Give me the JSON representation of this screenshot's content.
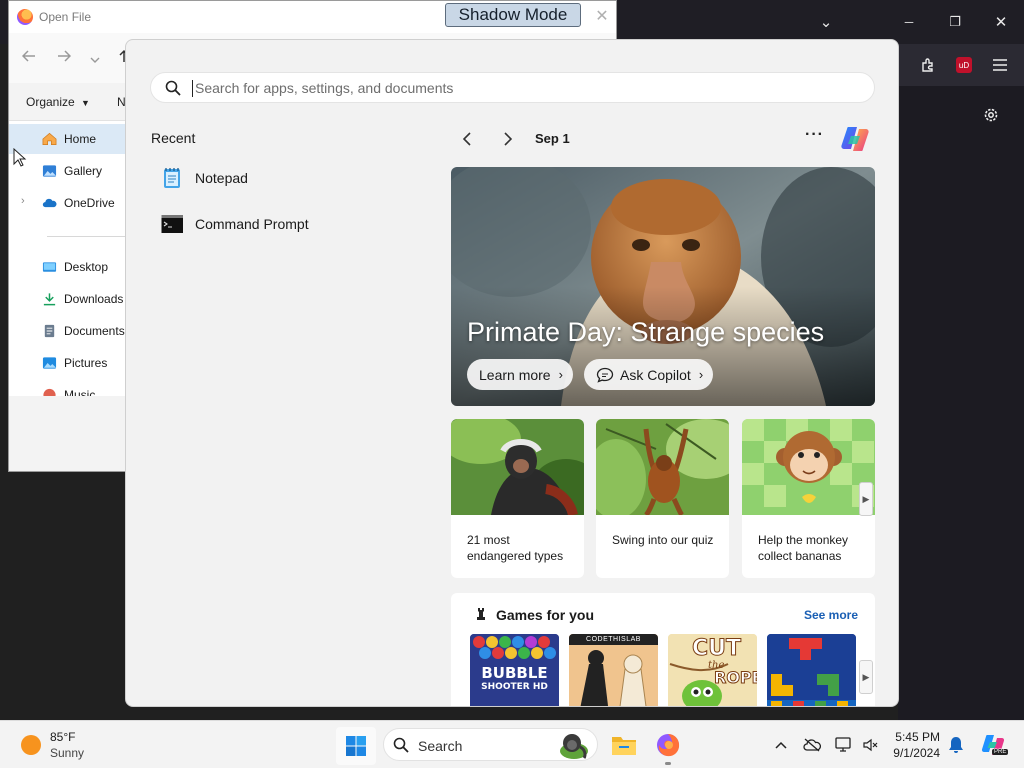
{
  "firefox": {
    "window_controls": {
      "list_all_tabs": "⌄",
      "minimize": "─",
      "maximize": "❐",
      "close": "✕"
    },
    "toolbar_icons": [
      "extensions-icon",
      "ublock-icon",
      "menu-icon"
    ],
    "ublock_badge": "uD"
  },
  "dialog": {
    "title": "Open File",
    "shadow_mode_label": "Shadow Mode",
    "close_glyph": "✕",
    "organize_label": "Organize",
    "new_folder_partial": "N",
    "nav_items": [
      {
        "label": "Home",
        "icon": "home-icon",
        "selected": true
      },
      {
        "label": "Gallery",
        "icon": "gallery-icon"
      },
      {
        "label": "OneDrive",
        "icon": "onedrive-icon",
        "expandable": true
      },
      {
        "label": "Desktop",
        "icon": "desktop-icon"
      },
      {
        "label": "Downloads",
        "icon": "downloads-icon"
      },
      {
        "label": "Documents",
        "icon": "documents-icon"
      },
      {
        "label": "Pictures",
        "icon": "pictures-icon"
      },
      {
        "label": "Music",
        "icon": "music-icon"
      }
    ]
  },
  "start_menu": {
    "search_placeholder": "Search for apps, settings, and documents",
    "recent_heading": "Recent",
    "recent_items": [
      {
        "label": "Notepad",
        "icon": "notepad-icon"
      },
      {
        "label": "Command Prompt",
        "icon": "command-prompt-icon"
      }
    ],
    "date_label": "Sep 1",
    "more_glyph": "···",
    "hero": {
      "title": "Primate Day: Strange species",
      "learn_more": "Learn more",
      "ask_copilot": "Ask Copilot"
    },
    "cards": [
      {
        "text": "21 most endangered types",
        "image": "colobus-monkey-photo"
      },
      {
        "text": "Swing into our quiz",
        "image": "orangutan-photo"
      },
      {
        "text": "Help the monkey collect bananas",
        "image": "cartoon-monkey-game"
      }
    ],
    "games": {
      "title": "Games for you",
      "see_more": "See more",
      "tiles": [
        {
          "name": "Bubble Shooter HD",
          "line1": "BUBBLE",
          "line2": "SHOOTER HD"
        },
        {
          "name": "Chess",
          "banner": "CODETHISLAB"
        },
        {
          "name": "Cut the Rope",
          "line1": "CUT",
          "line2": "the",
          "line3": "ROPE"
        },
        {
          "name": "Block puzzle"
        }
      ]
    }
  },
  "taskbar": {
    "weather_temp": "85°F",
    "weather_desc": "Sunny",
    "search_label": "Search",
    "clock_time": "5:45 PM",
    "clock_date": "9/1/2024",
    "copilot_badge": "PRE"
  }
}
